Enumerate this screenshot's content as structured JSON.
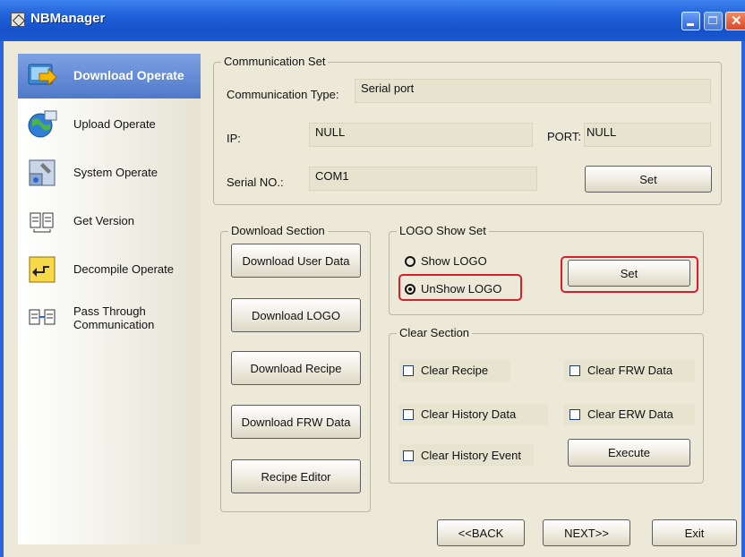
{
  "window": {
    "title": "NBManager"
  },
  "colors": {
    "accent_highlight": "#d61f2a",
    "titlebar": "#1e5fd8",
    "selected_item": "#5a82cf"
  },
  "sidebar": {
    "items": [
      {
        "label": "Download Operate",
        "icon": "download-arrow-icon",
        "selected": true
      },
      {
        "label": "Upload Operate",
        "icon": "globe-upload-icon"
      },
      {
        "label": "System Operate",
        "icon": "system-tools-icon"
      },
      {
        "label": "Get Version",
        "icon": "version-docs-icon"
      },
      {
        "label": "Decompile Operate",
        "icon": "decompile-folder-icon"
      },
      {
        "label": "Pass Through",
        "label2": "Communication",
        "icon": "pass-through-icon"
      }
    ]
  },
  "communication": {
    "group_title": "Communication Set",
    "type_label": "Communication Type:",
    "type_value": "Serial port",
    "ip_label": "IP:",
    "ip_value": "NULL",
    "port_label": "PORT:",
    "port_value": "NULL",
    "serial_label": "Serial NO.:",
    "serial_value": "COM1",
    "set_label": "Set"
  },
  "download": {
    "group_title": "Download Section",
    "buttons": [
      "Download User Data",
      "Download LOGO",
      "Download Recipe",
      "Download FRW Data",
      "Recipe Editor"
    ]
  },
  "logo": {
    "group_title": "LOGO Show Set",
    "show_label": "Show LOGO",
    "unshow_label": "UnShow LOGO",
    "selected": "UnShow LOGO",
    "set_label": "Set"
  },
  "clear": {
    "group_title": "Clear Section",
    "options": [
      "Clear Recipe",
      "Clear FRW Data",
      "Clear History Data",
      "Clear ERW Data",
      "Clear History Event"
    ],
    "execute_label": "Execute"
  },
  "nav": {
    "back": "<<BACK",
    "next": "NEXT>>",
    "exit": "Exit"
  }
}
